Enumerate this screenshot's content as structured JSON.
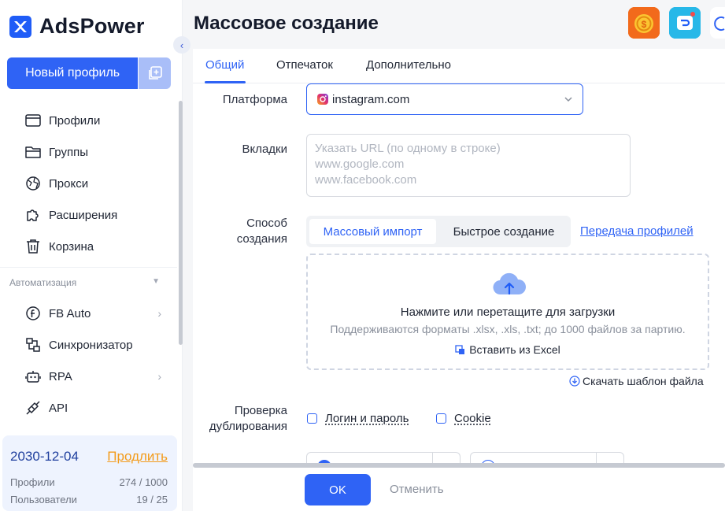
{
  "app": {
    "name": "AdsPower"
  },
  "sidebar": {
    "new_profile_label": "Новый профиль",
    "items": [
      {
        "label": "Профили",
        "icon": "profiles-icon"
      },
      {
        "label": "Группы",
        "icon": "folder-icon"
      },
      {
        "label": "Прокси",
        "icon": "proxy-globe-icon"
      },
      {
        "label": "Расширения",
        "icon": "puzzle-icon"
      },
      {
        "label": "Корзина",
        "icon": "trash-icon"
      }
    ],
    "automation_label": "Автоматизация",
    "automation_items": [
      {
        "label": "FB Auto",
        "icon": "facebook-auto-icon",
        "has_arrow": true
      },
      {
        "label": "Синхронизатор",
        "icon": "synchronizer-icon",
        "has_arrow": false
      },
      {
        "label": "RPA",
        "icon": "robot-icon",
        "has_arrow": true
      },
      {
        "label": "API",
        "icon": "api-plug-icon",
        "has_arrow": false
      }
    ],
    "plan": {
      "expiry": "2030-12-04",
      "renew_label": "Продлить",
      "profiles_label": "Профили",
      "profiles_value": "274 / 1000",
      "users_label": "Пользователи",
      "users_value": "19 / 25"
    }
  },
  "header": {
    "title": "Массовое создание"
  },
  "tabs": {
    "general": "Общий",
    "fingerprint": "Отпечаток",
    "advanced": "Дополнительно"
  },
  "form": {
    "platform_label": "Платформа",
    "platform_value": "instagram.com",
    "tabs_label": "Вкладки",
    "tabs_placeholder": "Указать URL (по одному в строке)\nwww.google.com\nwww.facebook.com",
    "method_label": "Способ создания",
    "method_bulk_import": "Массовый импорт",
    "method_quick_create": "Быстрое создание",
    "transfer_profiles_link": "Передача профилей",
    "upload_title": "Нажмите или перетащите для загрузки",
    "upload_hint": "Поддерживаются форматы .xlsx, .xls, .txt; до 1000 файлов за партию.",
    "paste_excel": "Вставить из Excel",
    "download_template": "Скачать шаблон файла",
    "dedup_label": "Проверка дублирования",
    "dedup_login": "Логин и пароль",
    "dedup_cookie": "Cookie"
  },
  "footer": {
    "ok": "OK",
    "cancel": "Отменить"
  },
  "colors": {
    "accent": "#2f63f5",
    "renew": "#f39b1a",
    "plan_bg": "#eef3fe"
  }
}
